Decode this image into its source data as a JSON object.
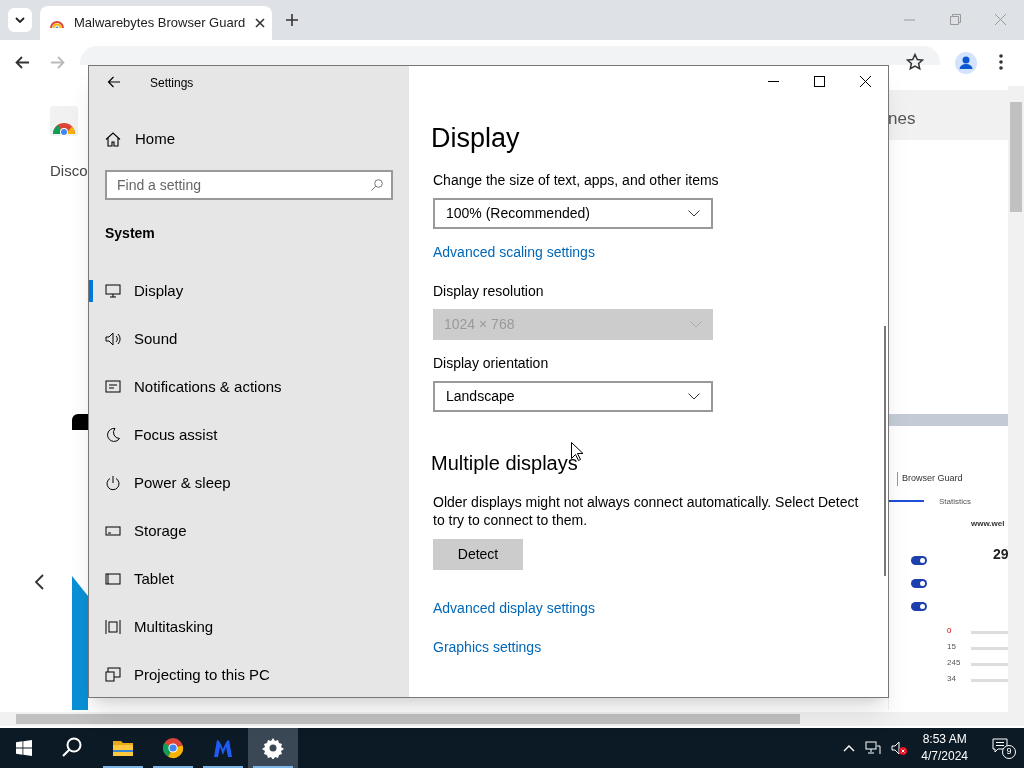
{
  "browser": {
    "tab_title": "Malwarebytes Browser Guard",
    "page": {
      "left_text": "Disco",
      "right_heading": "nes",
      "promo": {
        "title": "Browser Guard",
        "tab": "Statistics",
        "site": "www.wel",
        "count": "29",
        "toggles": [
          {
            "on": true
          },
          {
            "on": true
          },
          {
            "on": true
          }
        ],
        "stats": [
          "0",
          "15",
          "245",
          "34"
        ]
      }
    }
  },
  "settings": {
    "title": "Settings",
    "home": "Home",
    "search": {
      "placeholder": "Find a setting"
    },
    "section": "System",
    "nav": [
      {
        "label": "Display",
        "kind": "display",
        "selected": true
      },
      {
        "label": "Sound",
        "kind": "sound",
        "selected": false
      },
      {
        "label": "Notifications & actions",
        "kind": "notifications",
        "selected": false
      },
      {
        "label": "Focus assist",
        "kind": "focus",
        "selected": false
      },
      {
        "label": "Power & sleep",
        "kind": "power",
        "selected": false
      },
      {
        "label": "Storage",
        "kind": "storage",
        "selected": false
      },
      {
        "label": "Tablet",
        "kind": "tablet",
        "selected": false
      },
      {
        "label": "Multitasking",
        "kind": "multitasking",
        "selected": false
      },
      {
        "label": "Projecting to this PC",
        "kind": "projecting",
        "selected": false
      }
    ],
    "heading": "Display",
    "content": [
      {
        "kind": "label",
        "text": "Change the size of text, apps, and other items"
      },
      {
        "kind": "dropdown",
        "value": "100% (Recommended)",
        "disabled": false
      },
      {
        "kind": "link",
        "text": "Advanced scaling settings"
      },
      {
        "kind": "label",
        "text": "Display resolution"
      },
      {
        "kind": "dropdown",
        "value": "1024 × 768",
        "disabled": true
      },
      {
        "kind": "label",
        "text": "Display orientation"
      },
      {
        "kind": "dropdown",
        "value": "Landscape",
        "disabled": false
      },
      {
        "kind": "subheading",
        "text": "Multiple displays"
      },
      {
        "kind": "paragraph",
        "text": "Older displays might not always connect automatically. Select Detect to try to connect to them."
      },
      {
        "kind": "button",
        "text": "Detect"
      },
      {
        "kind": "link",
        "text": "Advanced display settings"
      },
      {
        "kind": "link",
        "text": "Graphics settings"
      }
    ]
  },
  "taskbar": {
    "apps": [
      {
        "kind": "search",
        "running": false,
        "selected": false
      },
      {
        "kind": "folder",
        "running": true,
        "selected": false
      },
      {
        "kind": "chrome",
        "running": true,
        "selected": false
      },
      {
        "kind": "malwarebytes",
        "running": true,
        "selected": false
      },
      {
        "kind": "settings",
        "running": true,
        "selected": true
      }
    ],
    "time": "8:53 AM",
    "date": "4/7/2024",
    "notifications": "9"
  }
}
